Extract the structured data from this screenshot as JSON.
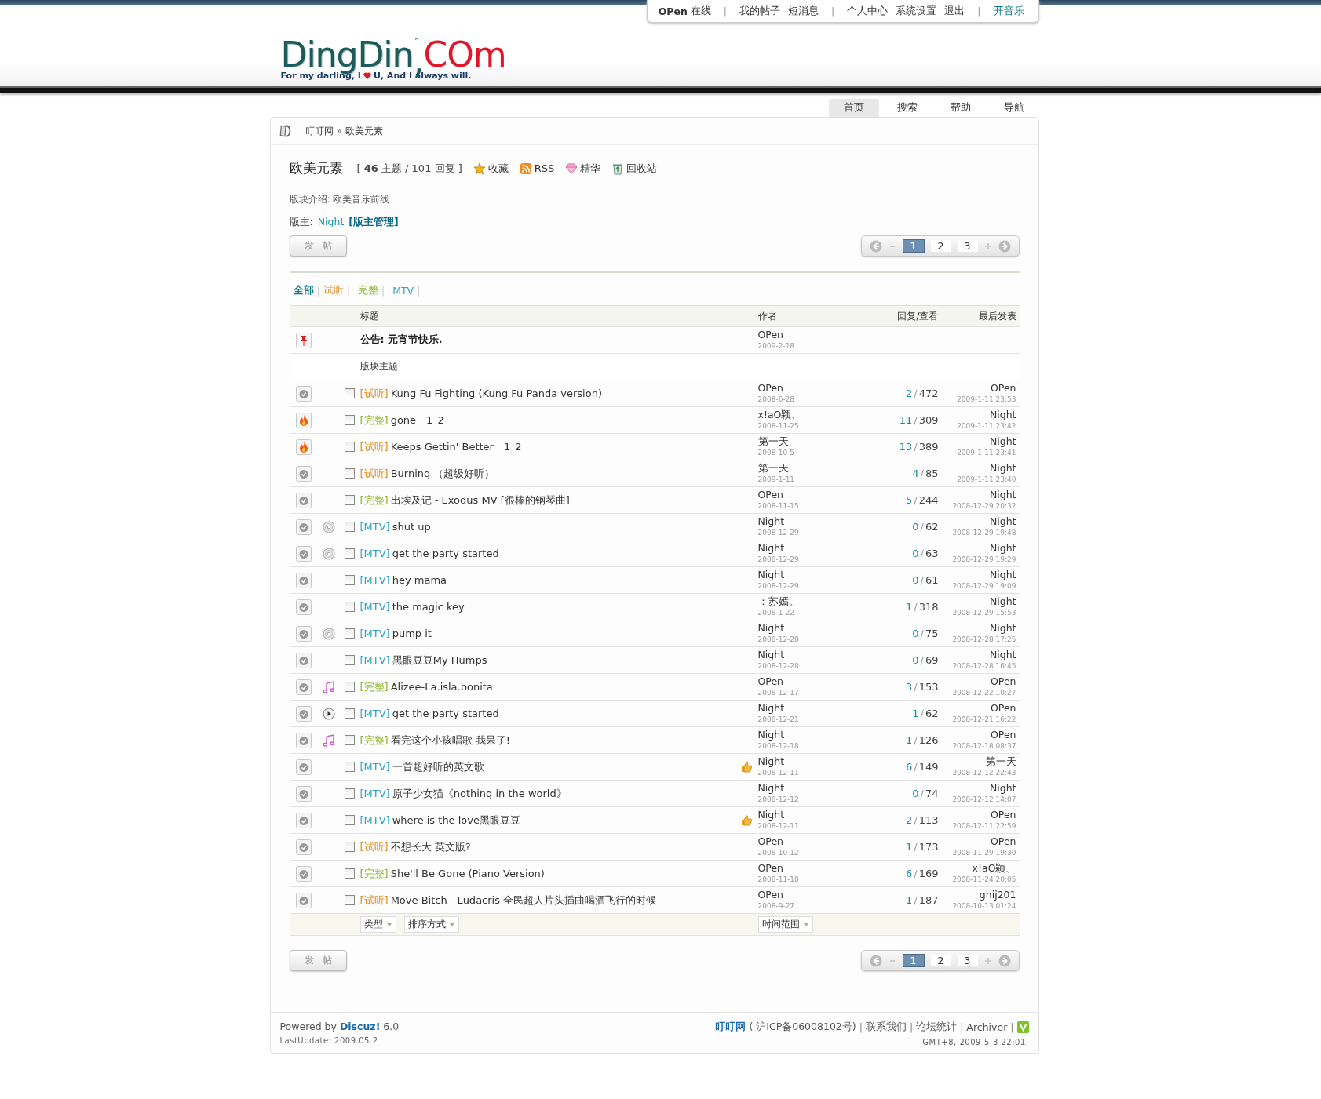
{
  "user_menu": {
    "name": "OPen",
    "status": "在线",
    "separators": [
      "|",
      "|",
      "|"
    ],
    "groups": [
      [
        "我的帖子",
        "短消息"
      ],
      [
        "个人中心",
        "系统设置",
        "退出"
      ]
    ],
    "music_link": "开音乐"
  },
  "logo": {
    "main": "DingDin",
    "tm": "™",
    "comma": ",",
    "tail": "COm",
    "tagline_before": "For my darling, I",
    "tagline_after": "U, And I always will."
  },
  "nav": [
    {
      "label": "首页",
      "selected": true
    },
    {
      "label": "搜索",
      "selected": false
    },
    {
      "label": "帮助",
      "selected": false
    },
    {
      "label": "导航",
      "selected": false
    }
  ],
  "breadcrumb": {
    "home": "叮叮网",
    "arrow": "»",
    "current": "欧美元素"
  },
  "forum": {
    "title": "欧美元素",
    "stats": "[ **46** 主题 / 101 回复 ]",
    "actions": [
      {
        "kind": "star",
        "label": "收藏"
      },
      {
        "kind": "rss",
        "label": "RSS"
      },
      {
        "kind": "gem",
        "label": "精华"
      },
      {
        "kind": "recycle",
        "label": "回收站"
      }
    ],
    "description": "版块介绍: 欧美音乐前线",
    "moderator_label": "版主:",
    "moderator": "Night",
    "moderator_admin": "[版主管理]"
  },
  "action_bars": [
    {
      "post_button": "发 帖",
      "pages": [
        {
          "label": "1",
          "selected": true
        },
        {
          "label": "2",
          "selected": false
        },
        {
          "label": "3",
          "selected": false
        }
      ]
    },
    {
      "post_button": "发 帖",
      "pages": [
        {
          "label": "1",
          "selected": true
        },
        {
          "label": "2",
          "selected": false
        },
        {
          "label": "3",
          "selected": false
        }
      ]
    }
  ],
  "filters": [
    {
      "label": "全部",
      "kind": "all",
      "selected": true,
      "separator": "|"
    },
    {
      "label": "试听",
      "kind": "trial",
      "selected": false,
      "separator": "|"
    },
    {
      "label": "完整",
      "kind": "full",
      "selected": false,
      "separator": "|"
    },
    {
      "label": "MTV",
      "kind": "mtv",
      "selected": false,
      "separator": "|"
    }
  ],
  "table": {
    "columns": [
      "标题",
      "作者",
      "回复/查看",
      "最后发表"
    ],
    "announcement": {
      "title": "公告: 元宵节快乐.",
      "author": "OPen",
      "date": "2009-2-18"
    },
    "section_label": "版块主题",
    "rows": [
      {
        "hot": false,
        "tag": {
          "text": "[试听]",
          "kind": "trial"
        },
        "title": "Kung Fu Fighting (Kung Fu Panda version)",
        "pages": [],
        "rated": false,
        "checked": false,
        "author": "OPen",
        "date": "2008-6-28",
        "replies": "2",
        "slash": "/",
        "views": "472",
        "last_by": "OPen",
        "last_time": "2009-1-11 23:53"
      },
      {
        "hot": true,
        "tag": {
          "text": "[完整]",
          "kind": "full"
        },
        "title": "gone",
        "pages": [
          "1",
          "2"
        ],
        "rated": false,
        "checked": false,
        "author": "x!aO颖、",
        "date": "2008-11-25",
        "replies": "11",
        "slash": "/",
        "views": "309",
        "last_by": "Night",
        "last_time": "2009-1-11 23:42"
      },
      {
        "hot": true,
        "tag": {
          "text": "[试听]",
          "kind": "trial"
        },
        "title": "Keeps Gettin' Better",
        "pages": [
          "1",
          "2"
        ],
        "rated": false,
        "checked": false,
        "author": "第一天",
        "date": "2008-10-5",
        "replies": "13",
        "slash": "/",
        "views": "389",
        "last_by": "Night",
        "last_time": "2009-1-11 23:41"
      },
      {
        "hot": false,
        "tag": {
          "text": "[试听]",
          "kind": "trial"
        },
        "title": "Burning （超级好听）",
        "pages": [],
        "rated": false,
        "checked": false,
        "author": "第一天",
        "date": "2009-1-11",
        "replies": "4",
        "slash": "/",
        "views": "85",
        "last_by": "Night",
        "last_time": "2009-1-11 23:40"
      },
      {
        "hot": false,
        "tag": {
          "text": "[完整]",
          "kind": "full"
        },
        "title": "出埃及记  - Exodus MV [很棒的钢琴曲]",
        "pages": [],
        "rated": false,
        "checked": false,
        "author": "OPen",
        "date": "2008-11-15",
        "replies": "5",
        "slash": "/",
        "views": "244",
        "last_by": "Night",
        "last_time": "2008-12-29 20:32"
      },
      {
        "hot": false,
        "attachment": {
          "kind": "disc"
        },
        "tag": {
          "text": "[MTV]",
          "kind": "mtv"
        },
        "title": "shut up",
        "pages": [],
        "rated": false,
        "checked": false,
        "author": "Night",
        "date": "2008-12-29",
        "replies": "0",
        "slash": "/",
        "views": "62",
        "last_by": "Night",
        "last_time": "2008-12-29 19:48"
      },
      {
        "hot": false,
        "attachment": {
          "kind": "disc"
        },
        "tag": {
          "text": "[MTV]",
          "kind": "mtv"
        },
        "title": "get the party started",
        "pages": [],
        "rated": false,
        "checked": false,
        "author": "Night",
        "date": "2008-12-29",
        "replies": "0",
        "slash": "/",
        "views": "63",
        "last_by": "Night",
        "last_time": "2008-12-29 19:29"
      },
      {
        "hot": false,
        "tag": {
          "text": "[MTV]",
          "kind": "mtv"
        },
        "title": "hey mama",
        "pages": [],
        "rated": false,
        "checked": false,
        "author": "Night",
        "date": "2008-12-29",
        "replies": "0",
        "slash": "/",
        "views": "61",
        "last_by": "Night",
        "last_time": "2008-12-29 19:09"
      },
      {
        "hot": false,
        "tag": {
          "text": "[MTV]",
          "kind": "mtv"
        },
        "title": "the magic key",
        "pages": [],
        "rated": false,
        "checked": false,
        "author": "：苏嫣。",
        "date": "2008-1-22",
        "replies": "1",
        "slash": "/",
        "views": "318",
        "last_by": "Night",
        "last_time": "2008-12-29 15:53"
      },
      {
        "hot": false,
        "attachment": {
          "kind": "disc"
        },
        "tag": {
          "text": "[MTV]",
          "kind": "mtv"
        },
        "title": "pump it",
        "pages": [],
        "rated": false,
        "checked": false,
        "author": "Night",
        "date": "2008-12-28",
        "replies": "0",
        "slash": "/",
        "views": "75",
        "last_by": "Night",
        "last_time": "2008-12-28 17:25"
      },
      {
        "hot": false,
        "tag": {
          "text": "[MTV]",
          "kind": "mtv"
        },
        "title": "黑眼豆豆My Humps",
        "pages": [],
        "rated": false,
        "checked": false,
        "author": "Night",
        "date": "2008-12-28",
        "replies": "0",
        "slash": "/",
        "views": "69",
        "last_by": "Night",
        "last_time": "2008-12-28 16:45"
      },
      {
        "hot": false,
        "attachment": {
          "kind": "music"
        },
        "tag": {
          "text": "[完整]",
          "kind": "full"
        },
        "title": "Alizee-La.isla.bonita",
        "pages": [],
        "rated": false,
        "checked": false,
        "author": "OPen",
        "date": "2008-12-17",
        "replies": "3",
        "slash": "/",
        "views": "153",
        "last_by": "OPen",
        "last_time": "2008-12-22 10:27"
      },
      {
        "hot": false,
        "attachment": {
          "kind": "play"
        },
        "tag": {
          "text": "[MTV]",
          "kind": "mtv"
        },
        "title": "get the party started",
        "pages": [],
        "rated": false,
        "checked": false,
        "author": "Night",
        "date": "2008-12-21",
        "replies": "1",
        "slash": "/",
        "views": "62",
        "last_by": "OPen",
        "last_time": "2008-12-21 16:22"
      },
      {
        "hot": false,
        "attachment": {
          "kind": "music"
        },
        "tag": {
          "text": "[完整]",
          "kind": "full"
        },
        "title": "看完这个小孩唱歌  我呆了!",
        "pages": [],
        "rated": false,
        "checked": false,
        "author": "Night",
        "date": "2008-12-18",
        "replies": "1",
        "slash": "/",
        "views": "126",
        "last_by": "OPen",
        "last_time": "2008-12-18 08:37"
      },
      {
        "hot": false,
        "tag": {
          "text": "[MTV]",
          "kind": "mtv"
        },
        "title": "一首超好听的英文歌",
        "pages": [],
        "rated": true,
        "checked": false,
        "author": "Night",
        "date": "2008-12-11",
        "replies": "6",
        "slash": "/",
        "views": "149",
        "last_by": "第一天",
        "last_time": "2008-12-12 22:43"
      },
      {
        "hot": false,
        "tag": {
          "text": "[MTV]",
          "kind": "mtv"
        },
        "title": "原子少女猫《nothing in the world》",
        "pages": [],
        "rated": false,
        "checked": false,
        "author": "Night",
        "date": "2008-12-12",
        "replies": "0",
        "slash": "/",
        "views": "74",
        "last_by": "Night",
        "last_time": "2008-12-12 14:07"
      },
      {
        "hot": false,
        "tag": {
          "text": "[MTV]",
          "kind": "mtv"
        },
        "title": "where is the love黑眼豆豆",
        "pages": [],
        "rated": true,
        "checked": false,
        "author": "Night",
        "date": "2008-12-11",
        "replies": "2",
        "slash": "/",
        "views": "113",
        "last_by": "OPen",
        "last_time": "2008-12-11 22:59"
      },
      {
        "hot": false,
        "tag": {
          "text": "[试听]",
          "kind": "trial"
        },
        "title": "不想长大  英文版?",
        "pages": [],
        "rated": false,
        "checked": false,
        "author": "OPen",
        "date": "2008-10-12",
        "replies": "1",
        "slash": "/",
        "views": "173",
        "last_by": "OPen",
        "last_time": "2008-11-29 19:30"
      },
      {
        "hot": false,
        "tag": {
          "text": "[完整]",
          "kind": "full"
        },
        "title": "She'll Be Gone (Piano Version)",
        "pages": [],
        "rated": false,
        "checked": false,
        "author": "OPen",
        "date": "2008-11-18",
        "replies": "6",
        "slash": "/",
        "views": "169",
        "last_by": "x!aO颖、",
        "last_time": "2008-11-24 20:05"
      },
      {
        "hot": false,
        "tag": {
          "text": "[试听]",
          "kind": "trial"
        },
        "title": "Move Bitch - Ludacris 全民超人片头插曲喝酒飞行的时候",
        "pages": [],
        "rated": false,
        "checked": false,
        "author": "OPen",
        "date": "2008-9-27",
        "replies": "1",
        "slash": "/",
        "views": "187",
        "last_by": "ghij201",
        "last_time": "2008-10-13 01:24"
      }
    ],
    "selects": [
      "类型",
      "排序方式"
    ],
    "time_select": "时间范围"
  },
  "footer": {
    "powered_before": "Powered by",
    "powered_brand": "Discuz!",
    "powered_version": "6.0",
    "last_update": "LastUpdate: 2009.05.2",
    "site": "叮叮网",
    "icp": "( 沪ICP备06008102号)",
    "links": [
      {
        "separator": "|",
        "label": "联系我们"
      },
      {
        "separator": "|",
        "label": "论坛统计"
      },
      {
        "separator": "|",
        "label": "Archiver"
      }
    ],
    "badge_separator": "|",
    "time": "GMT+8, 2009-5-3 22:01."
  }
}
